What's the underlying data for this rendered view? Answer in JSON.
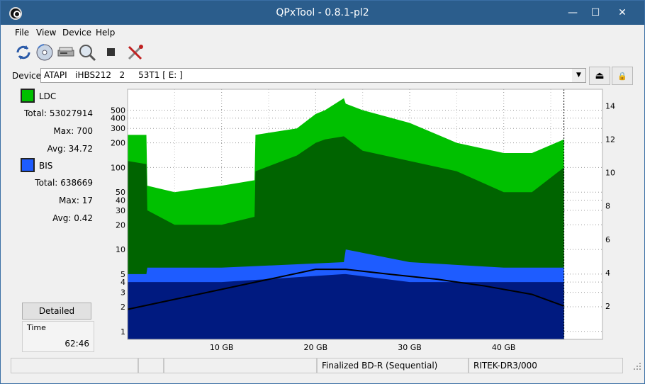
{
  "window": {
    "title": "QPxTool - 0.8.1-pl2",
    "min_glyph": "—",
    "max_glyph": "☐",
    "close_glyph": "✕"
  },
  "menu": {
    "items": [
      "File",
      "View",
      "Device",
      "Help"
    ]
  },
  "toolbar": {
    "icons": [
      "refresh-icon",
      "disc-icon",
      "drive-icon",
      "scan-icon",
      "stop-icon",
      "tools-icon"
    ]
  },
  "device": {
    "label": "Device:",
    "value": "ATAPI   iHBS212   2     53T1 [ E: ]",
    "dropdown_glyph": "▼",
    "eject_glyph": "⏏",
    "lock_glyph": "🔒"
  },
  "legend": {
    "ldc": {
      "name": "LDC",
      "color": "#00c000",
      "total_label": "Total:",
      "total": "53027914",
      "max_label": "Max:",
      "max": "700",
      "avg_label": "Avg:",
      "avg": "34.72"
    },
    "bis": {
      "name": "BIS",
      "color": "#1e5cff",
      "total_label": "Total:",
      "total": "638669",
      "max_label": "Max:",
      "max": "17",
      "avg_label": "Avg:",
      "avg": "0.42"
    }
  },
  "buttons": {
    "detailed": "Detailed"
  },
  "time": {
    "label": "Time",
    "value": "62:46"
  },
  "status": {
    "disc_type": "Finalized BD-R (Sequential)",
    "media_id": "RITEK-DR3/000"
  },
  "chart_data": {
    "type": "area",
    "title": "",
    "xlabel": "",
    "ylabel": "",
    "x_unit": "GB",
    "x_ticks": [
      "10 GB",
      "20 GB",
      "30 GB",
      "40 GB"
    ],
    "x_tick_values": [
      10,
      20,
      30,
      40
    ],
    "xlim": [
      0,
      50.5
    ],
    "y_scale": "log",
    "ylim_left": [
      0.8,
      900
    ],
    "y_left_ticks": [
      1,
      2,
      3,
      4,
      5,
      10,
      20,
      30,
      40,
      50,
      100,
      200,
      300,
      400,
      500
    ],
    "ylim_right": [
      0,
      15
    ],
    "y_right_ticks": [
      2,
      4,
      6,
      8,
      10,
      12,
      14
    ],
    "grid": true,
    "colors": {
      "ldc": "#00c000",
      "ldc_dark": "#006400",
      "bis": "#1e5cff",
      "bis_dark": "#001a80",
      "speed": "#000000"
    },
    "series": [
      {
        "name": "LDC",
        "x": [
          0,
          2,
          2.1,
          5,
          10,
          13.5,
          13.6,
          18,
          20,
          21,
          23,
          23.2,
          25,
          30,
          35,
          40,
          43,
          46.4
        ],
        "values": [
          120,
          110,
          30,
          20,
          20,
          25,
          90,
          140,
          200,
          220,
          240,
          230,
          160,
          120,
          90,
          50,
          50,
          100
        ],
        "max": [
          250,
          250,
          60,
          50,
          60,
          70,
          250,
          300,
          450,
          500,
          700,
          600,
          500,
          350,
          200,
          150,
          150,
          220
        ]
      },
      {
        "name": "BIS",
        "x": [
          0,
          2,
          2.1,
          10,
          23,
          23.2,
          30,
          40,
          46.4
        ],
        "values": [
          4,
          4,
          4,
          4,
          5,
          5,
          4,
          4,
          4
        ],
        "max": [
          5,
          5,
          6,
          6,
          7,
          10,
          7,
          6,
          6
        ]
      },
      {
        "name": "",
        "axis": "right",
        "x": [
          0,
          5,
          10,
          15,
          20,
          23.2,
          28,
          33,
          38,
          43,
          46.4
        ],
        "values": [
          1.8,
          2.4,
          3.0,
          3.6,
          4.2,
          4.2,
          3.9,
          3.6,
          3.2,
          2.7,
          2.0
        ]
      }
    ]
  }
}
